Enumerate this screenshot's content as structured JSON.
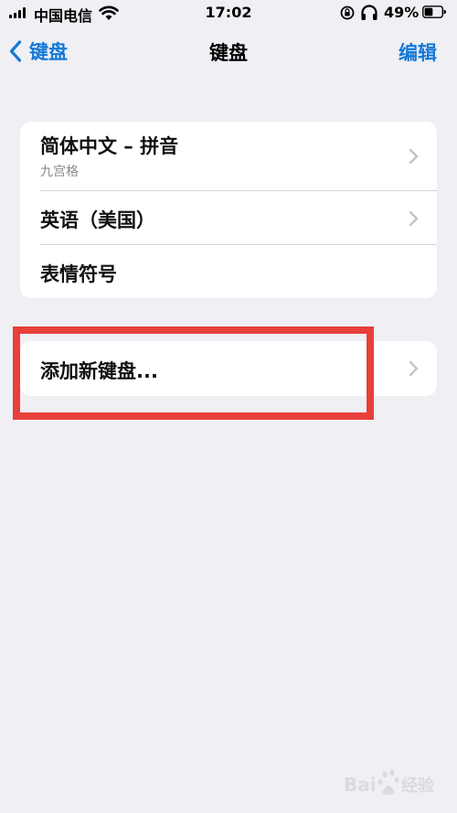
{
  "status_bar": {
    "carrier": "中国电信",
    "time": "17:02",
    "battery_percent": "49%",
    "battery_level": 0.49
  },
  "nav": {
    "back_label": "键盘",
    "title": "键盘",
    "edit_label": "编辑"
  },
  "keyboards": [
    {
      "title": "简体中文 – 拼音",
      "subtitle": "九宫格"
    },
    {
      "title": "英语（美国）"
    },
    {
      "title": "表情符号"
    }
  ],
  "add_keyboard_label": "添加新键盘...",
  "colors": {
    "accent": "#1478d7",
    "background": "#efeff4",
    "highlight": "#e8403a"
  },
  "watermark": {
    "text": "Baidu 经验"
  }
}
